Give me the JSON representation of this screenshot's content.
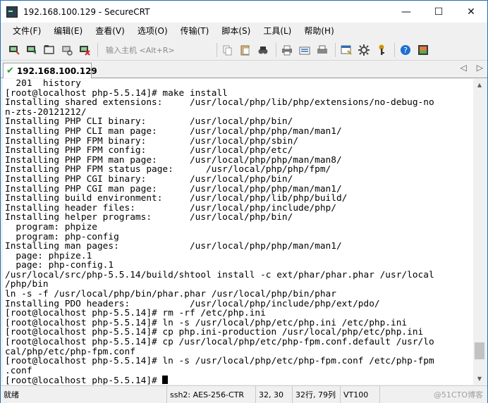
{
  "window": {
    "title": "192.168.100.129 - SecureCRT",
    "controls": {
      "minimize": "—",
      "maximize": "☐",
      "close": "✕"
    }
  },
  "menu": [
    "文件(F)",
    "编辑(E)",
    "查看(V)",
    "选项(O)",
    "传输(T)",
    "脚本(S)",
    "工具(L)",
    "帮助(H)"
  ],
  "toolbar": {
    "quick_connect_placeholder": "输入主机 <Alt+R>"
  },
  "tab": {
    "label": "192.168.100.129",
    "prev_arrow": "◁",
    "next_arrow": "▷"
  },
  "terminal": {
    "lines": [
      "  201  history",
      "[root@localhost php-5.5.14]# make install",
      "Installing shared extensions:     /usr/local/php/lib/php/extensions/no-debug-no",
      "n-zts-20121212/",
      "Installing PHP CLI binary:        /usr/local/php/bin/",
      "Installing PHP CLI man page:      /usr/local/php/php/man/man1/",
      "Installing PHP FPM binary:        /usr/local/php/sbin/",
      "Installing PHP FPM config:        /usr/local/php/etc/",
      "Installing PHP FPM man page:      /usr/local/php/php/man/man8/",
      "Installing PHP FPM status page:      /usr/local/php/php/fpm/",
      "Installing PHP CGI binary:        /usr/local/php/bin/",
      "Installing PHP CGI man page:      /usr/local/php/php/man/man1/",
      "Installing build environment:     /usr/local/php/lib/php/build/",
      "Installing header files:          /usr/local/php/include/php/",
      "Installing helper programs:       /usr/local/php/bin/",
      "  program: phpize",
      "  program: php-config",
      "Installing man pages:             /usr/local/php/php/man/man1/",
      "  page: phpize.1",
      "  page: php-config.1",
      "/usr/local/src/php-5.5.14/build/shtool install -c ext/phar/phar.phar /usr/local",
      "/php/bin",
      "ln -s -f /usr/local/php/bin/phar.phar /usr/local/php/bin/phar",
      "Installing PDO headers:           /usr/local/php/include/php/ext/pdo/",
      "[root@localhost php-5.5.14]# rm -rf /etc/php.ini",
      "[root@localhost php-5.5.14]# ln -s /usr/local/php/etc/php.ini /etc/php.ini",
      "[root@localhost php-5.5.14]# cp php.ini-production /usr/local/php/etc/php.ini",
      "[root@localhost php-5.5.14]# cp /usr/local/php/etc/php-fpm.conf.default /usr/lo",
      "cal/php/etc/php-fpm.conf",
      "[root@localhost php-5.5.14]# ln -s /usr/local/php/etc/php-fpm.conf /etc/php-fpm",
      ".conf"
    ],
    "prompt": "[root@localhost php-5.5.14]# "
  },
  "scrollbar": {
    "position_fraction": 0.95,
    "thumb_fraction": 0.06
  },
  "status": {
    "ready": "就绪",
    "protocol": "ssh2: AES-256-CTR",
    "cursor_pos": "32,  30",
    "size": "32行, 79列",
    "terminal_type": "VT100"
  },
  "watermark": "@51CTO博客"
}
